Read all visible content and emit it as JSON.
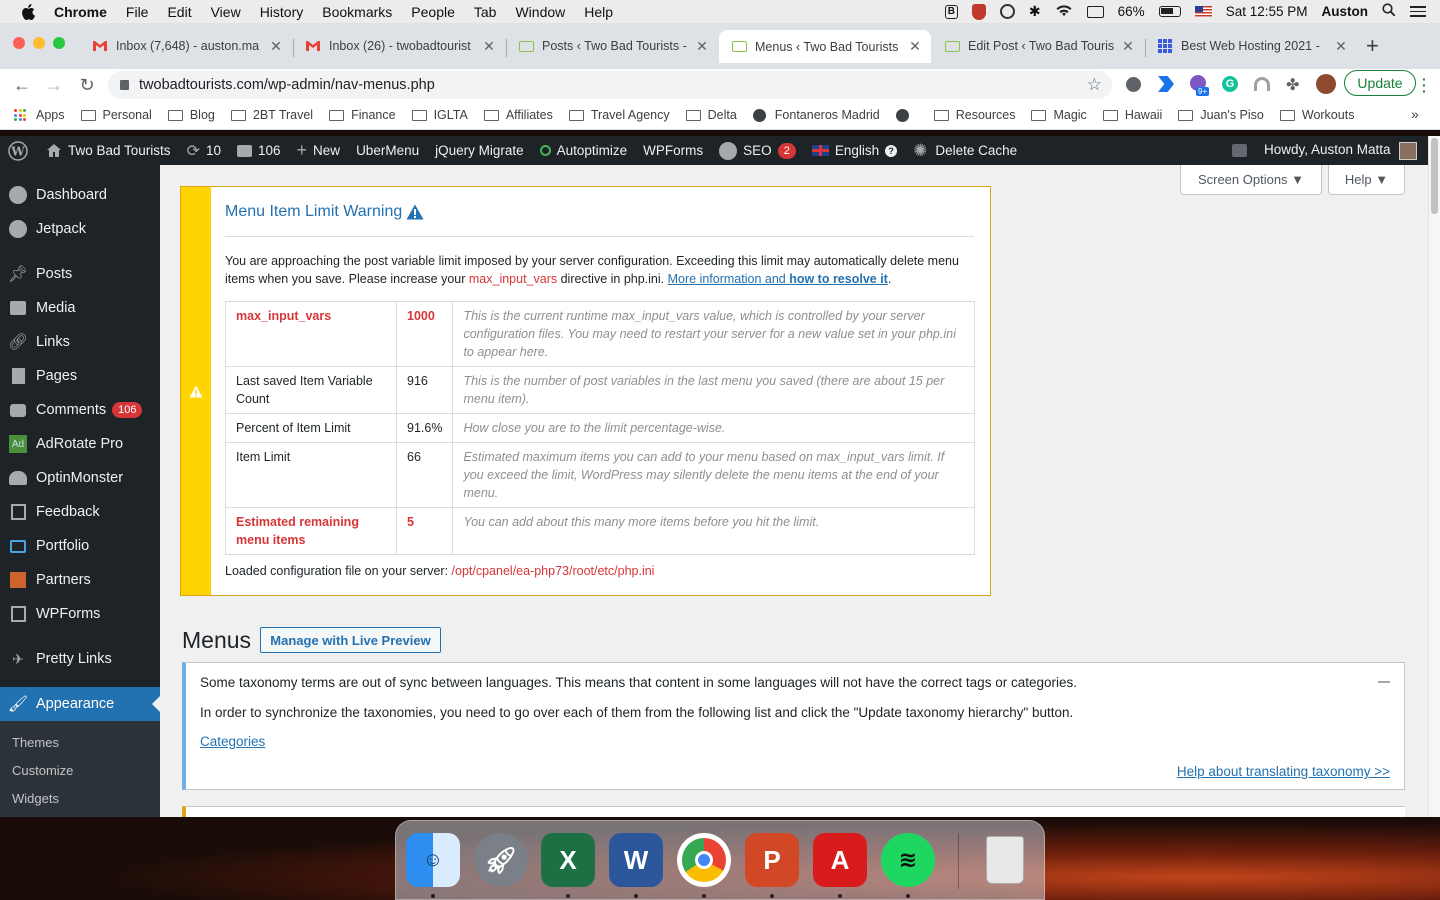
{
  "macos": {
    "menubar": [
      "Chrome",
      "File",
      "Edit",
      "View",
      "History",
      "Bookmarks",
      "People",
      "Tab",
      "Window",
      "Help"
    ],
    "battery": "66%",
    "clock": "Sat 12:55 PM",
    "user": "Auston"
  },
  "browser": {
    "tabs": [
      {
        "label": "Inbox (7,648) - auston.ma",
        "icon": "gmail-icon"
      },
      {
        "label": "Inbox (26) - twobadtourist",
        "icon": "gmail-icon"
      },
      {
        "label": "Posts ‹ Two Bad Tourists -",
        "icon": "site-icon"
      },
      {
        "label": "Menus ‹ Two Bad Tourists",
        "icon": "site-icon",
        "active": true
      },
      {
        "label": "Edit Post ‹ Two Bad Touris",
        "icon": "site-icon"
      },
      {
        "label": "Best Web Hosting 2021 -",
        "icon": "grid-icon"
      }
    ],
    "url": "twobadtourists.com/wp-admin/nav-menus.php",
    "update_label": "Update",
    "extension_badge": "9+",
    "bookmarks": [
      "Apps",
      "Personal",
      "Blog",
      "2BT Travel",
      "Finance",
      "IGLTA",
      "Affiliates",
      "Travel Agency",
      "Delta",
      "Fontaneros Madrid",
      "",
      "Resources",
      "Magic",
      "Hawaii",
      "Juan's Piso",
      "Workouts"
    ],
    "bookmarks_more": "»"
  },
  "adminbar": {
    "site": "Two Bad Tourists",
    "updates": "10",
    "comments": "106",
    "new": "New",
    "ubermenu": "UberMenu",
    "jquery": "jQuery Migrate",
    "autoptimize": "Autoptimize",
    "wpforms": "WPForms",
    "seo": "SEO",
    "seo_count": "2",
    "language": "English",
    "delete_cache": "Delete Cache",
    "howdy": "Howdy, Auston Matta"
  },
  "sidebar": {
    "items": [
      {
        "label": "Dashboard",
        "icon": "dashboard-icon"
      },
      {
        "label": "Jetpack",
        "icon": "jetpack-icon"
      },
      {
        "label": "Posts",
        "icon": "pin-icon"
      },
      {
        "label": "Media",
        "icon": "media-icon"
      },
      {
        "label": "Links",
        "icon": "link-icon"
      },
      {
        "label": "Pages",
        "icon": "page-icon"
      },
      {
        "label": "Comments",
        "icon": "comment-icon",
        "badge": "106"
      },
      {
        "label": "AdRotate Pro",
        "icon": "adrotate-icon"
      },
      {
        "label": "OptinMonster",
        "icon": "optinmonster-icon"
      },
      {
        "label": "Feedback",
        "icon": "feedback-icon"
      },
      {
        "label": "Portfolio",
        "icon": "portfolio-icon"
      },
      {
        "label": "Partners",
        "icon": "partners-icon"
      },
      {
        "label": "WPForms",
        "icon": "wpforms-icon"
      },
      {
        "label": "Pretty Links",
        "icon": "prettylinks-icon"
      },
      {
        "label": "Appearance",
        "icon": "brush-icon",
        "current": true
      }
    ],
    "submenu": [
      "Themes",
      "Customize",
      "Widgets"
    ]
  },
  "screen_options": {
    "screen": "Screen Options ▼",
    "help": "Help ▼"
  },
  "warning": {
    "title": "Menu Item Limit Warning",
    "para_1": "You are approaching the post variable limit imposed by your server configuration. Exceeding this limit may automatically delete menu items when you save. Please increase your ",
    "para_var": "max_input_vars",
    "para_2": " directive in php.ini. ",
    "para_link": "More information and ",
    "para_link2": "how to resolve it",
    "para_end": ".",
    "rows": [
      {
        "name": "max_input_vars",
        "value": "1000",
        "desc": "This is the current runtime max_input_vars value, which is controlled by your server configuration files. You may need to restart your server for a new value set in your php.ini to appear here.",
        "highlight": true
      },
      {
        "name": "Last saved Item Variable Count",
        "value": "916",
        "desc": "This is the number of post variables in the last menu you saved (there are about 15 per menu item)."
      },
      {
        "name": "Percent of Item Limit",
        "value": "91.6%",
        "desc": "How close you are to the limit percentage-wise."
      },
      {
        "name": "Item Limit",
        "value": "66",
        "desc": "Estimated maximum items you can add to your menu based on max_input_vars limit. If you exceed the limit, WordPress may silently delete the menu items at the end of your menu."
      },
      {
        "name": "Estimated remaining menu items",
        "value": "5",
        "desc": "You can add about this many more items before you hit the limit.",
        "highlight": true
      }
    ],
    "footer_label": "Loaded configuration file on your server: ",
    "footer_path": "/opt/cpanel/ea-php73/root/etc/php.ini"
  },
  "menus": {
    "heading": "Menus",
    "live_preview": "Manage with Live Preview"
  },
  "notice": {
    "line1": "Some taxonomy terms are out of sync between languages. This means that content in some languages will not have the correct tags or categories.",
    "line2": "In order to synchronize the taxonomies, you need to go over each of them from the following list and click the \"Update taxonomy hierarchy\" button.",
    "categories": "Categories",
    "help_link": "Help about translating taxonomy >>"
  },
  "dock": [
    "Finder",
    "Launchpad",
    "Excel",
    "Word",
    "Chrome",
    "PowerPoint",
    "Acrobat",
    "Spotify",
    "Trash"
  ]
}
